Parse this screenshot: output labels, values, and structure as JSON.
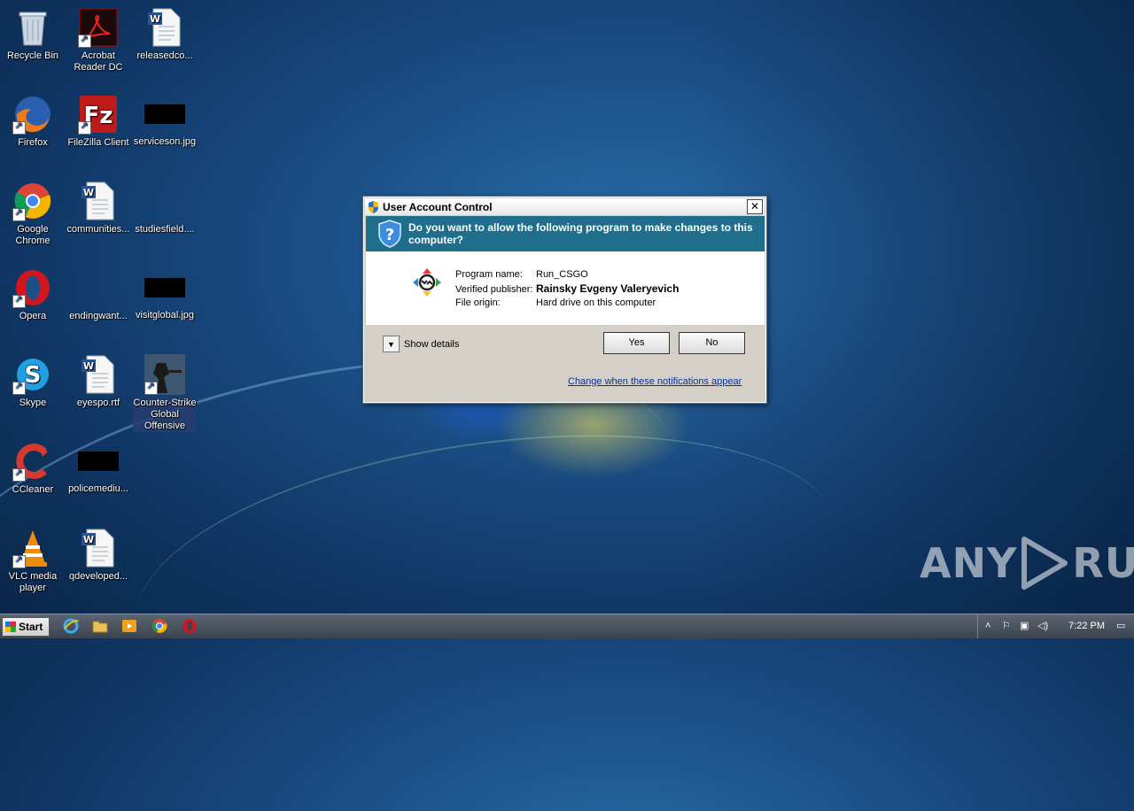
{
  "desktop": {
    "icons": [
      {
        "label": "Recycle Bin",
        "icon": "recycle-bin-icon"
      },
      {
        "label": "Acrobat\nReader DC",
        "icon": "acrobat-icon"
      },
      {
        "label": "releasedco...",
        "icon": "word-doc-icon"
      },
      {
        "label": "Firefox",
        "icon": "firefox-icon"
      },
      {
        "label": "FileZilla Client",
        "icon": "filezilla-icon"
      },
      {
        "label": "serviceson.jpg",
        "icon": "image-thumbnail-icon"
      },
      {
        "label": "Google\nChrome",
        "icon": "chrome-icon"
      },
      {
        "label": "communities...",
        "icon": "word-doc-icon"
      },
      {
        "label": "studiesfield....",
        "icon": "image-thumbnail-icon"
      },
      {
        "label": "Opera",
        "icon": "opera-icon"
      },
      {
        "label": "endingwant...",
        "icon": "image-thumbnail-icon"
      },
      {
        "label": "visitglobal.jpg",
        "icon": "image-thumbnail-icon"
      },
      {
        "label": "Skype",
        "icon": "skype-icon"
      },
      {
        "label": "eyespo.rtf",
        "icon": "word-doc-icon"
      },
      {
        "label": "Counter-Strike\nGlobal\nOffensive",
        "icon": "csgo-icon"
      },
      {
        "label": "CCleaner",
        "icon": "ccleaner-icon"
      },
      {
        "label": "policemediu...",
        "icon": "image-thumbnail-icon"
      },
      {
        "label": "VLC media\nplayer",
        "icon": "vlc-icon"
      },
      {
        "label": "qdeveloped...",
        "icon": "word-doc-icon"
      }
    ]
  },
  "dialog": {
    "title": "User Account Control",
    "close_label": "✕",
    "question": "Do you want to allow the following program to make changes to this computer?",
    "program_name_label": "Program name:",
    "program_name": "Run_CSGO",
    "publisher_label": "Verified publisher:",
    "publisher": "Rainsky Evgeny Valeryevich",
    "origin_label": "File origin:",
    "origin": "Hard drive on this computer",
    "show_details": "Show details",
    "yes_label": "Yes",
    "no_label": "No",
    "notifications_link": "Change when these notifications appear"
  },
  "taskbar": {
    "start_label": "Start",
    "clock": "7:22 PM"
  },
  "watermark": {
    "left": "ANY",
    "right": "RUN"
  }
}
